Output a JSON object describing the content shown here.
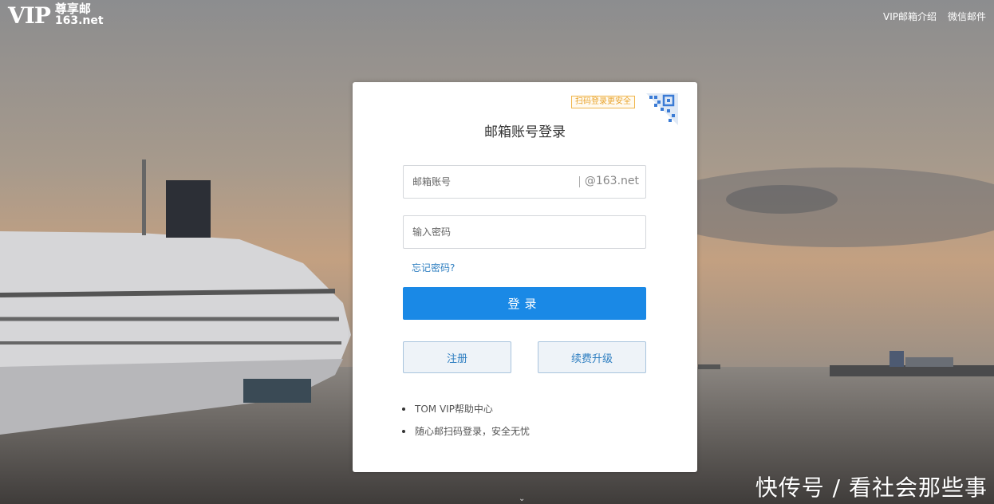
{
  "header": {
    "logo_mark": "VIP",
    "logo_cn": "尊享邮",
    "logo_domain": "163.net",
    "nav": [
      "VIP邮箱介绍",
      "微信邮件"
    ]
  },
  "login": {
    "qr_tip": "扫码登录更安全",
    "title": "邮箱账号登录",
    "account_placeholder": "邮箱账号",
    "domain_suffix": "@163.net",
    "password_placeholder": "输入密码",
    "forgot": "忘记密码?",
    "submit": "登录",
    "register": "注册",
    "renew": "续费升级",
    "links": [
      "TOM VIP帮助中心",
      "随心邮扫码登录，安全无忧"
    ]
  },
  "watermark": "快传号 / 看社会那些事",
  "colors": {
    "primary": "#1a89e6",
    "link": "#2f7fc1",
    "tip": "#e9a531"
  }
}
